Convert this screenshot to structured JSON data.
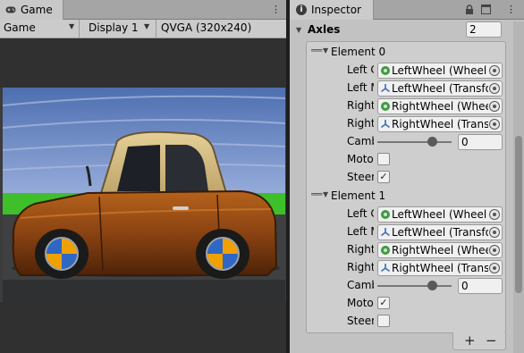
{
  "game": {
    "tab_label": "Game",
    "display_mode": "Game",
    "display": "Display 1",
    "resolution": "QVGA (320x240)"
  },
  "inspector": {
    "tab_label": "Inspector",
    "axles_label": "Axles",
    "axles_size": "2",
    "elements": [
      {
        "label": "Element 0",
        "left_collider_label": "Left C",
        "left_collider_value": "LeftWheel (Wheel C",
        "left_mesh_label": "Left M",
        "left_mesh_value": "LeftWheel (Transfo",
        "right_collider_label": "Right",
        "right_collider_value": "RightWheel (Wheel",
        "right_mesh_label": "Right",
        "right_mesh_value": "RightWheel (Transf",
        "camber_label": "Camb",
        "camber_value": "0",
        "motor_label": "Motor",
        "motor_checked": false,
        "steering_label": "Steer",
        "steering_checked": true
      },
      {
        "label": "Element 1",
        "left_collider_label": "Left C",
        "left_collider_value": "LeftWheel (Wheel C",
        "left_mesh_label": "Left M",
        "left_mesh_value": "LeftWheel (Transfo",
        "right_collider_label": "Right",
        "right_collider_value": "RightWheel (Wheel",
        "right_mesh_label": "Right",
        "right_mesh_value": "RightWheel (Transf",
        "camber_label": "Camb",
        "camber_value": "0",
        "motor_label": "Motor",
        "motor_checked": true,
        "steering_label": "Steer",
        "steering_checked": false
      }
    ],
    "add_button": "+",
    "remove_button": "−"
  }
}
